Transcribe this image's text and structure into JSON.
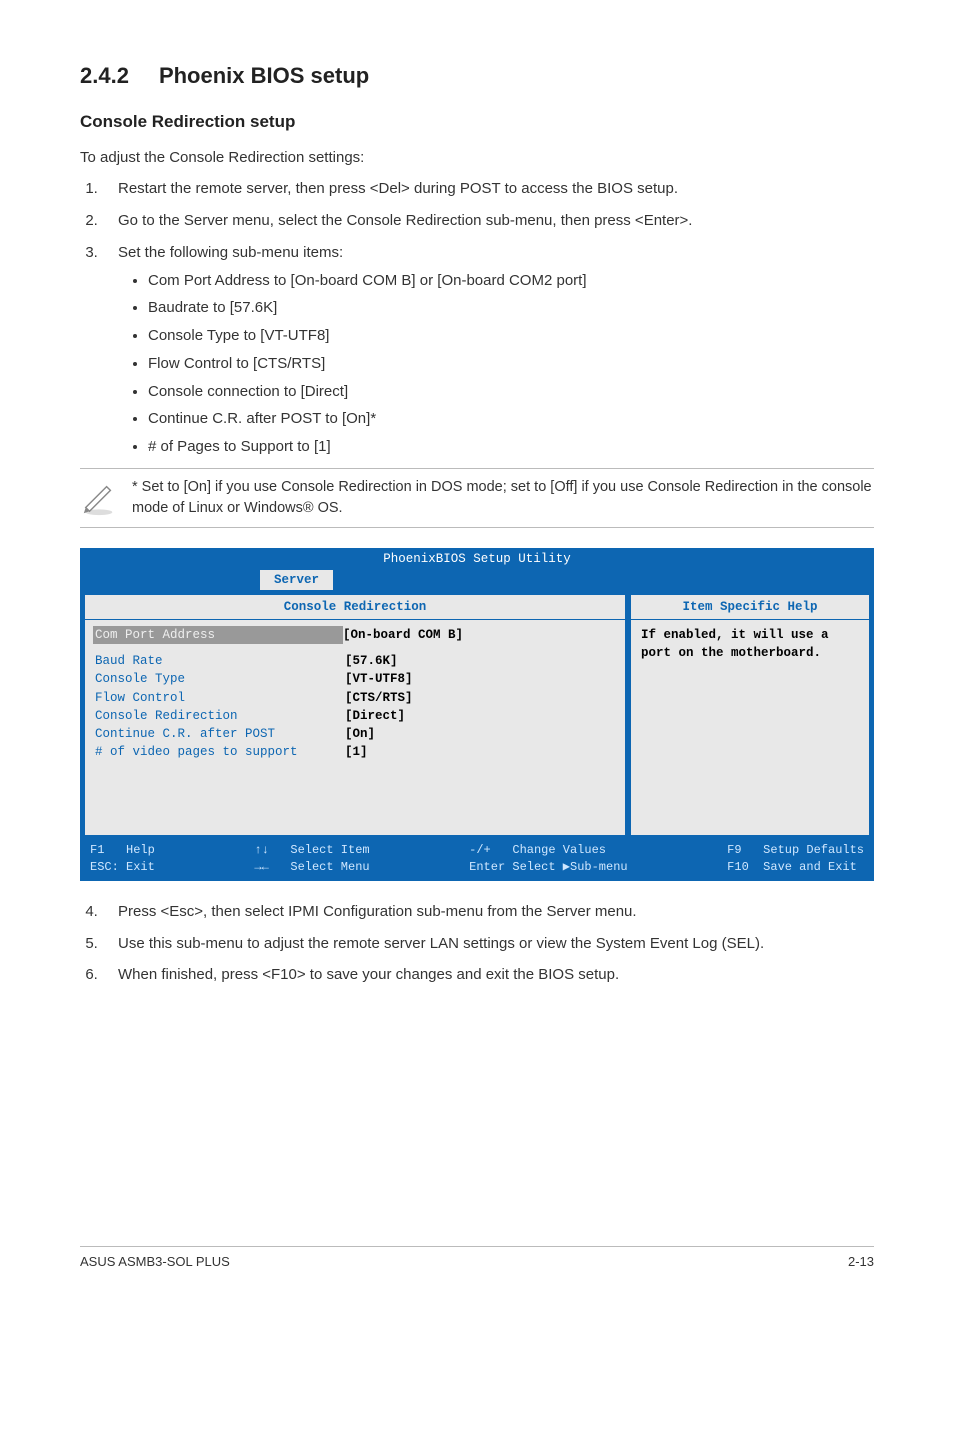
{
  "section": {
    "number": "2.4.2",
    "title": "Phoenix BIOS setup"
  },
  "subhead": "Console Redirection setup",
  "intro": "To adjust the Console Redirection settings:",
  "steps_top": [
    "Restart the remote server, then press <Del> during POST to access the BIOS setup.",
    "Go to the Server menu, select the Console Redirection sub-menu, then press <Enter>.",
    "Set the following sub-menu items:"
  ],
  "submenu_items": [
    "Com Port Address to [On-board COM B] or [On-board COM2 port]",
    "Baudrate to [57.6K]",
    "Console Type to [VT-UTF8]",
    "Flow Control to [CTS/RTS]",
    "Console connection to [Direct]",
    "Continue C.R. after POST to [On]*",
    "# of Pages to Support to [1]"
  ],
  "note": "* Set to [On] if you use Console Redirection in DOS mode; set to [Off] if you use Console Redirection in the console mode of Linux or Windows® OS.",
  "bios": {
    "title": "PhoenixBIOS Setup Utility",
    "tab": "Server",
    "panel_title": "Console Redirection",
    "help_title": "Item Specific Help",
    "help_text": "If enabled, it will use a port on the motherboard.",
    "rows": [
      {
        "k": "Com Port Address",
        "v": "[On-board COM B]",
        "selected": true
      },
      {
        "k": "Baud Rate",
        "v": "[57.6K]"
      },
      {
        "k": "Console Type",
        "v": "[VT-UTF8]"
      },
      {
        "k": "Flow Control",
        "v": "[CTS/RTS]"
      },
      {
        "k": "Console Redirection",
        "v": "[Direct]"
      },
      {
        "k": "Continue C.R. after POST",
        "v": "[On]"
      },
      {
        "k": "# of video pages to support",
        "v": "[1]"
      }
    ],
    "footer": {
      "c1a": "F1   Help",
      "c1b": "ESC: Exit",
      "c2a": "↑↓   Select Item",
      "c2b": "→←   Select Menu",
      "c3a": "-/+   Change Values",
      "c3b": "Enter Select ▶Sub-menu",
      "c4a": "F9   Setup Defaults",
      "c4b": "F10  Save and Exit"
    }
  },
  "steps_bottom": [
    "Press <Esc>, then select IPMI Configuration sub-menu from the Server menu.",
    "Use this sub-menu to adjust the remote server LAN settings or view the System Event Log (SEL).",
    "When finished, press <F10> to save your changes and exit the BIOS setup."
  ],
  "page_footer_left": "ASUS ASMB3-SOL PLUS",
  "page_footer_right": "2-13"
}
